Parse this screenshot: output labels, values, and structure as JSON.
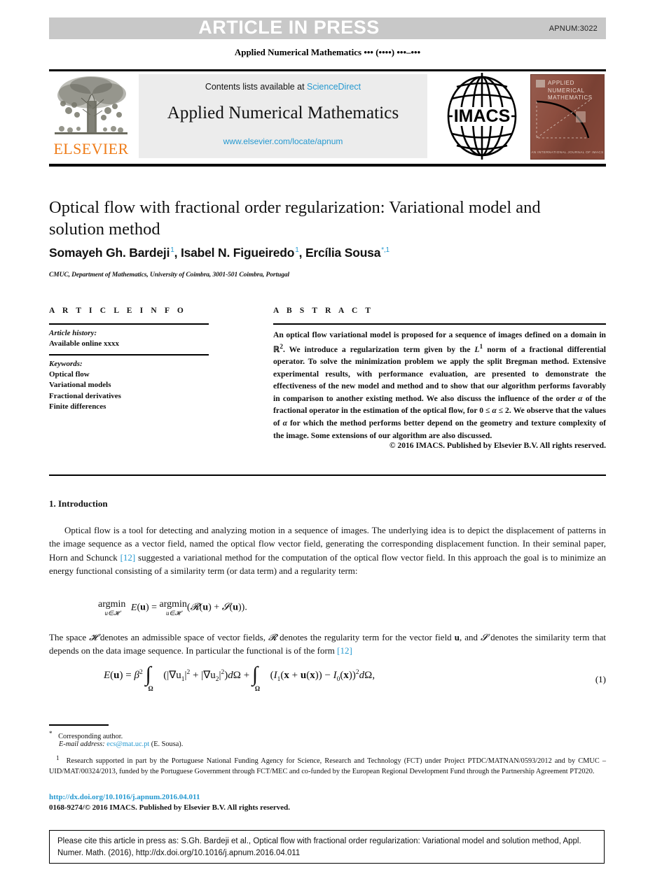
{
  "header": {
    "press_banner": "ARTICLE IN PRESS",
    "article_code": "APNUM:3022",
    "running_head": "Applied Numerical Mathematics ••• (••••) •••–•••"
  },
  "banner": {
    "publisher_name": "ELSEVIER",
    "contents_prefix": "Contents lists available at ",
    "contents_link": "ScienceDirect",
    "journal_name": "Applied Numerical Mathematics",
    "journal_url": "www.elsevier.com/locate/apnum",
    "society_logo_text": "IMACS",
    "cover_title": "APPLIED NUMERICAL MATHEMATICS",
    "cover_footer": "AN INTERNATIONAL JOURNAL OF IMACS"
  },
  "article": {
    "title": "Optical flow with fractional order regularization: Variational model and solution method",
    "authors_html": "Somayeh Gh. Bardeji <sup>1</sup>, Isabel N. Figueiredo <sup>1</sup>, Ercília Sousa<sup>*,1</sup>",
    "authors_plain": "Somayeh Gh. Bardeji 1, Isabel N. Figueiredo 1, Ercília Sousa *,1",
    "affiliation": "CMUC, Department of Mathematics, University of Coimbra, 3001-501 Coimbra, Portugal"
  },
  "info": {
    "heading": "A R T I C L E    I N F O",
    "history_label": "Article history:",
    "history_value": "Available online xxxx",
    "keywords_label": "Keywords:",
    "keywords": [
      "Optical flow",
      "Variational models",
      "Fractional derivatives",
      "Finite differences"
    ]
  },
  "abstract": {
    "heading": "A B S T R A C T",
    "body": "An optical flow variational model is proposed for a sequence of images defined on a domain in ℝ2. We introduce a regularization term given by the L1 norm of a fractional differential operator. To solve the minimization problem we apply the split Bregman method. Extensive experimental results, with performance evaluation, are presented to demonstrate the effectiveness of the new model and method and to show that our algorithm performs favorably in comparison to another existing method. We also discuss the influence of the order α of the fractional operator in the estimation of the optical flow, for 0 ≤ α ≤ 2. We observe that the values of α for which the method performs better depend on the geometry and texture complexity of the image. Some extensions of our algorithm are also discussed.",
    "copyright": "© 2016 IMACS. Published by Elsevier B.V. All rights reserved."
  },
  "section1": {
    "heading": "1. Introduction",
    "paragraph1": "Optical flow is a tool for detecting and analyzing motion in a sequence of images. The underlying idea is to depict the displacement of patterns in the image sequence as a vector field, named the optical flow vector field, generating the corresponding displacement function. In their seminal paper, Horn and Schunck [12] suggested a variational method for the computation of the optical flow vector field. In this approach the goal is to minimize an energy functional consisting of a similarity term (or data term) and a regularity term:",
    "equation_argmin": "argmin E(u) = argmin(R(u) + S(u)).",
    "equation_argmin_sub": "u∈H",
    "paragraph2": "The space H denotes an admissible space of vector fields, R denotes the regularity term for the vector field u, and S denotes the similarity term that depends on the data image sequence. In particular the functional is of the form [12]",
    "equation1": "E(u) = β2 ∫Ω (|∇u1|2 + |∇u2|2)dΩ + ∫Ω (I1(x + u(x)) − I0(x))2dΩ,",
    "equation1_number": "(1)",
    "reference_marker": "[12]"
  },
  "footnotes": {
    "corresponding_mark": "*",
    "corresponding": "Corresponding author.",
    "email_label": "E-mail address:",
    "email": "ecs@mat.uc.pt",
    "email_owner": "(E. Sousa).",
    "funding_mark": "1",
    "funding": "Research supported in part by the Portuguese National Funding Agency for Science, Research and Technology (FCT) under Project PTDC/MATNAN/0593/2012 and by CMUC – UID/MAT/00324/2013, funded by the Portuguese Government through FCT/MEC and co-funded by the European Regional Development Fund through the Partnership Agreement PT2020."
  },
  "imprint": {
    "doi_url": "http://dx.doi.org/10.1016/j.apnum.2016.04.011",
    "issn_line": "0168-9274/© 2016 IMACS. Published by Elsevier B.V. All rights reserved."
  },
  "cite_box": {
    "text": "Please cite this article in press as: S.Gh. Bardeji et al., Optical flow with fractional order regularization: Variational model and solution method, Appl. Numer. Math. (2016), http://dx.doi.org/10.1016/j.apnum.2016.04.011"
  },
  "colors": {
    "link": "#2699d0",
    "elsevier_orange": "#ef7d1a",
    "press_band": "#c8c8c8",
    "banner_grey": "#ececec",
    "cover_brown": "#8a4a3b"
  }
}
